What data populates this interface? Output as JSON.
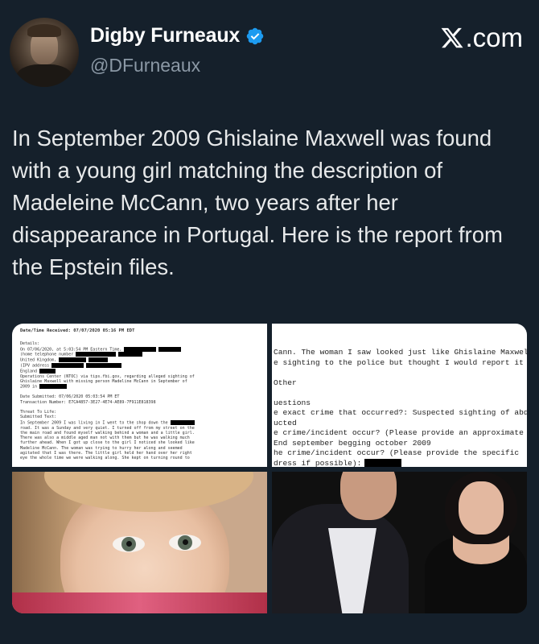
{
  "header": {
    "display_name": "Digby Furneaux",
    "handle": "@DFurneaux",
    "brand": ".com",
    "verified_icon": "verified-badge-icon",
    "brand_icon": "x-logo-icon"
  },
  "tweet": {
    "text": "In September 2009 Ghislaine Maxwell was found with a young girl matching the description of Madeleine McCann, two years after her disappearance in Portugal. Here is the report from the Epstein files."
  },
  "media": {
    "doc1": {
      "header": "Date/Time Received:  07/07/2020 05:16 PM EDT",
      "lines": [
        "Details:",
        "On 07/06/2020, at 5:03:54 PM Eastern Time,",
        "   (home telephone number",
        "   United Kingdom,",
        "(IPV address",
        "England",
        "Operations Center (NTOC) via tips.fbi.gov, regarding alleged sighting of",
        "Ghislaine Maxwell with missing person Madeline McCann in September of",
        "2009 in",
        "",
        "Date Submitted: 07/06/2020 05:03:54 PM ET",
        "Transaction Number: E7CA4857-3E27-4E74-AE89-7F911E818398",
        "",
        "Threat To Life:",
        "Submitted Text:",
        "In September 2009 I was living in        I went to the shop down the",
        "road. It was a Sunday and very quiet. I turned off from my street on the",
        "the main road and found myself walking behind a woman and a little girl.",
        "There was also a middle aged man not with them but he was walking much",
        "further ahead. When I got up close to the girl I noticed she looked like",
        "Madeline McCann. The woman was trying to hurry her along and seemed",
        "agitated that I was there. The little girl held her hand over her right",
        "eye the whole time we were walking along. She kept on turning round to"
      ]
    },
    "doc2": {
      "lines": [
        "Cann. The woman I saw looked just like Ghislaine Maxwell. I",
        "e sighting to the police but thought I would report it to you",
        "",
        "Other",
        "",
        "uestions",
        "e exact crime that occurred?: Suspected sighting of abducted",
        "ucted",
        "e crime/incident occur? (Please provide an approximate date",
        "End september begging october 2009",
        "he crime/incident occur? (Please provide the specific",
        "dress if possible):"
      ]
    },
    "photo_girl": "girl-photo",
    "photo_couple": "couple-photo"
  }
}
